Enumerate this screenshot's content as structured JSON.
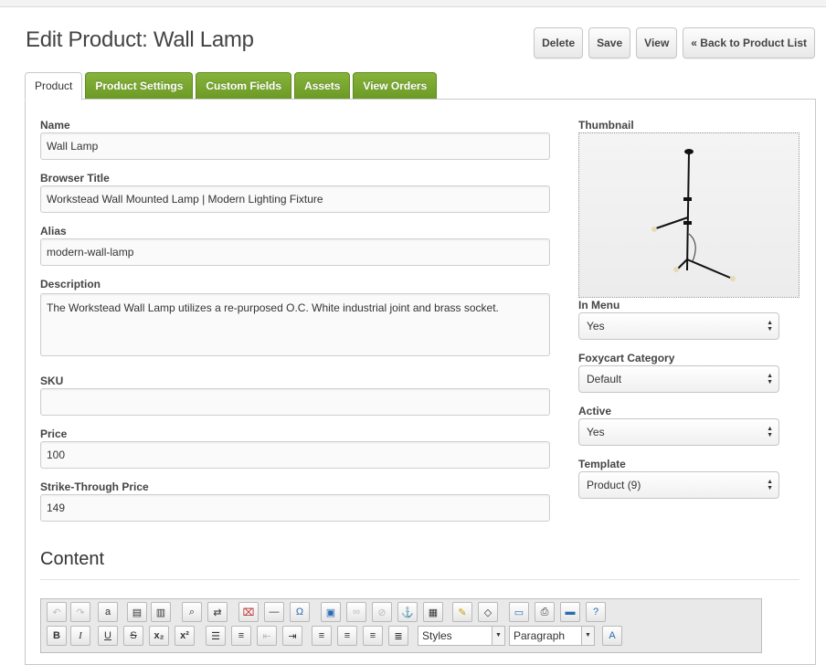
{
  "page": {
    "title": "Edit Product: Wall Lamp"
  },
  "actions": {
    "delete": "Delete",
    "save": "Save",
    "view": "View",
    "back": "« Back to Product List"
  },
  "tabs": [
    "Product",
    "Product Settings",
    "Custom Fields",
    "Assets",
    "View Orders"
  ],
  "form": {
    "name_label": "Name",
    "name_value": "Wall Lamp",
    "browser_title_label": "Browser Title",
    "browser_title_value": "Workstead Wall Mounted Lamp | Modern Lighting Fixture",
    "alias_label": "Alias",
    "alias_value": "modern-wall-lamp",
    "description_label": "Description",
    "description_value": "The Workstead Wall Lamp utilizes a re-purposed O.C. White industrial joint and brass socket.",
    "sku_label": "SKU",
    "sku_value": "",
    "price_label": "Price",
    "price_value": "100",
    "strike_label": "Strike-Through Price",
    "strike_value": "149"
  },
  "sidebar": {
    "thumbnail_label": "Thumbnail",
    "in_menu_label": "In Menu",
    "in_menu_value": "Yes",
    "category_label": "Foxycart Category",
    "category_value": "Default",
    "active_label": "Active",
    "active_value": "Yes",
    "template_label": "Template",
    "template_value": "Product (9)"
  },
  "content": {
    "title": "Content",
    "styles_value": "Styles",
    "format_value": "Paragraph"
  },
  "colors": {
    "tab_green": "#76a32c",
    "tab_border": "#5e8a1f"
  }
}
